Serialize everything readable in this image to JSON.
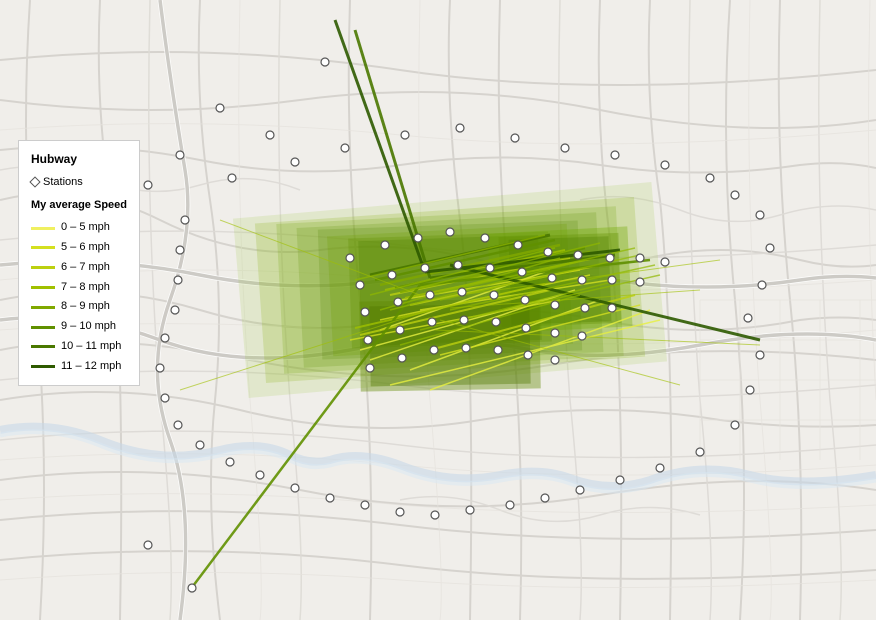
{
  "legend": {
    "title": "Hubway",
    "subtitle": "Stations",
    "speed_title": "My average Speed",
    "items": [
      {
        "label": "0 – 5 mph",
        "color": "#f0f060"
      },
      {
        "label": "5 – 6 mph",
        "color": "#d4e020"
      },
      {
        "label": "6 – 7 mph",
        "color": "#bcd010"
      },
      {
        "label": "7 – 8 mph",
        "color": "#a0c000"
      },
      {
        "label": "8 – 9 mph",
        "color": "#80a800"
      },
      {
        "label": "9 – 10 mph",
        "color": "#609000"
      },
      {
        "label": "10 – 11 mph",
        "color": "#4a7800"
      },
      {
        "label": "11 – 12 mph",
        "color": "#2e5a00"
      }
    ]
  }
}
